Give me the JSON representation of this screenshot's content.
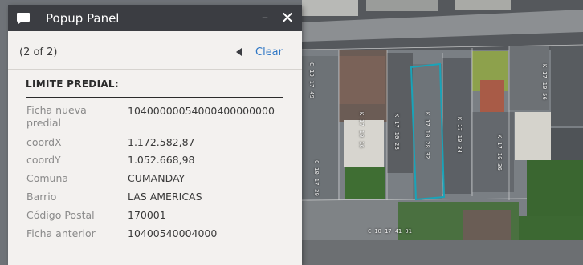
{
  "popup": {
    "title": "Popup Panel",
    "title_icon": "speech-bubble-icon",
    "minimize_label": "–",
    "close_label": "✕",
    "counter": "(2 of 2)",
    "prev_icon": "triangle-left-icon",
    "clear_label": "Clear",
    "section_title": "LIMITE PREDIAL:",
    "fields": [
      {
        "label": "Ficha nueva predial",
        "value": "10400000054000400000000"
      },
      {
        "label": "coordX",
        "value": "1.172.582,87"
      },
      {
        "label": "coordY",
        "value": "1.052.668,98"
      },
      {
        "label": "Comuna",
        "value": "CUMANDAY"
      },
      {
        "label": "Barrio",
        "value": "LAS AMERICAS"
      },
      {
        "label": "Código Postal",
        "value": "170001"
      },
      {
        "label": "Ficha anterior",
        "value": "10400540004000"
      }
    ]
  },
  "map": {
    "parcel_labels": [
      "C 10 17 49",
      "K 17 10 16",
      "K 17 10 28",
      "K 17 10 28 32",
      "K 17 10 34",
      "K 17 10 36",
      "C 10 17 39",
      "C 10 17 41 01",
      "K 17 10 56"
    ],
    "highlight_color": "#1aa3b8"
  }
}
